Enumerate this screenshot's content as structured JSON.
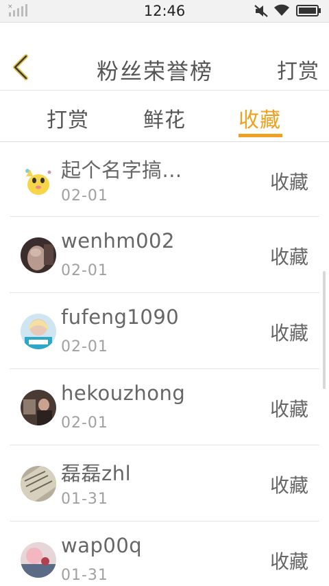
{
  "status_bar": {
    "time": "12:46"
  },
  "nav": {
    "title": "粉丝荣誉榜",
    "action": "打赏"
  },
  "tabs": [
    {
      "label": "打赏"
    },
    {
      "label": "鲜花"
    },
    {
      "label": "收藏"
    }
  ],
  "selected_tab": "收藏",
  "colors": {
    "accent": "#f0a01e",
    "text": "#666666",
    "subtext": "#a0a0a0"
  },
  "items": [
    {
      "name": "起个名字搞...",
      "date": "02-01",
      "action": "收藏"
    },
    {
      "name": "wenhm002",
      "date": "02-01",
      "action": "收藏"
    },
    {
      "name": "fufeng1090",
      "date": "02-01",
      "action": "收藏"
    },
    {
      "name": "hekouzhong",
      "date": "02-01",
      "action": "收藏"
    },
    {
      "name": "磊磊zhl",
      "date": "01-31",
      "action": "收藏"
    },
    {
      "name": "wap00q",
      "date": "01-31",
      "action": "收藏"
    }
  ]
}
